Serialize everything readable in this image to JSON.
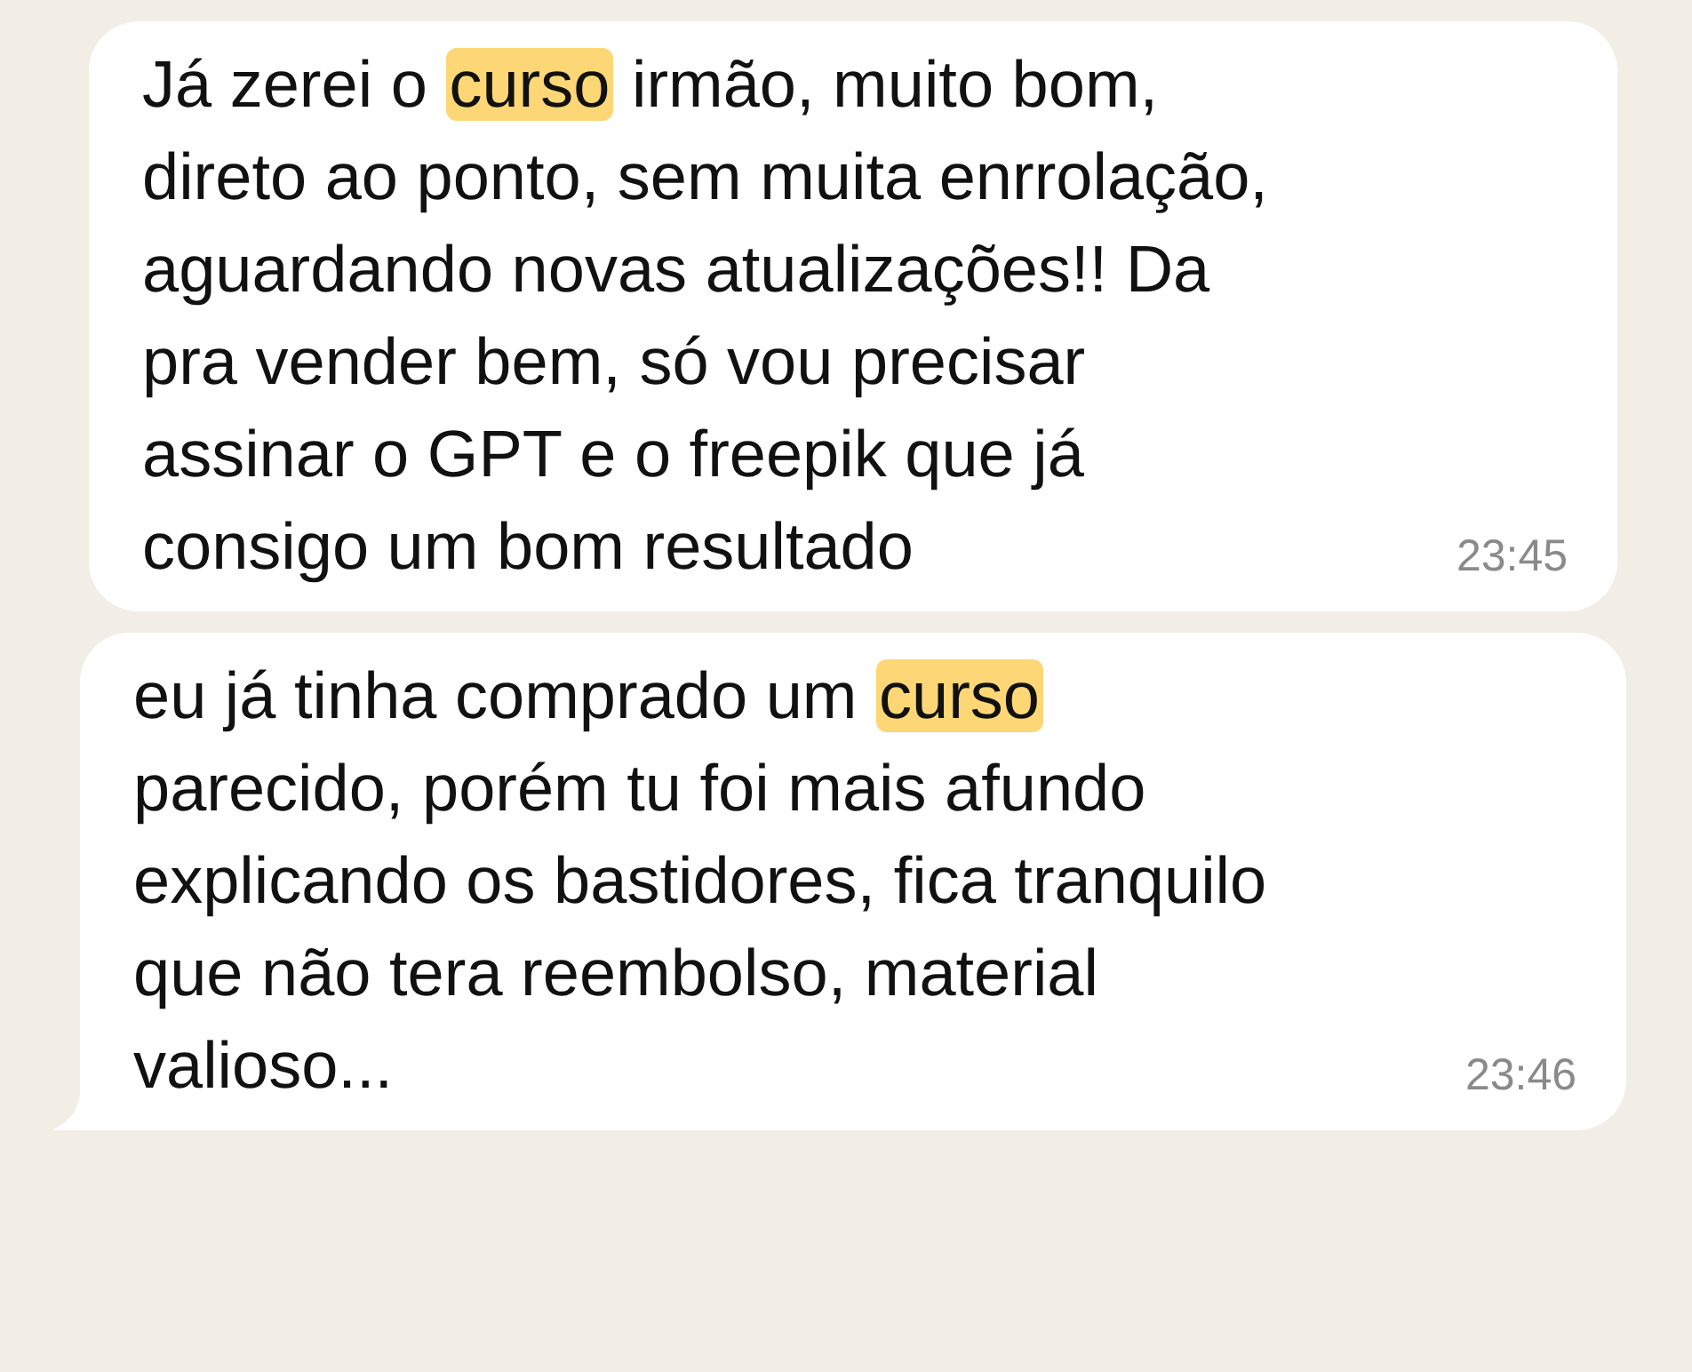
{
  "messages": [
    {
      "lines": [
        [
          {
            "text": "Já zerei o ",
            "highlighted": false
          },
          {
            "text": "curso",
            "highlighted": true
          },
          {
            "text": " irmão, muito bom,",
            "highlighted": false
          }
        ],
        [
          {
            "text": "direto ao ponto, sem muita enrrolação,",
            "highlighted": false
          }
        ],
        [
          {
            "text": "aguardando novas atualizações!! Da",
            "highlighted": false
          }
        ],
        [
          {
            "text": "pra vender bem, só vou precisar",
            "highlighted": false
          }
        ],
        [
          {
            "text": "assinar o GPT e o freepik que já",
            "highlighted": false
          }
        ],
        [
          {
            "text": "consigo um bom resultado",
            "highlighted": false
          }
        ]
      ],
      "time": "23:45",
      "tail": false
    },
    {
      "lines": [
        [
          {
            "text": "eu já tinha comprado um ",
            "highlighted": false
          },
          {
            "text": "curso",
            "highlighted": true
          }
        ],
        [
          {
            "text": "parecido, porém tu foi mais afundo",
            "highlighted": false
          }
        ],
        [
          {
            "text": "explicando os bastidores, fica tranquilo",
            "highlighted": false
          }
        ],
        [
          {
            "text": "que não tera reembolso, material",
            "highlighted": false
          }
        ],
        [
          {
            "text": "valioso...",
            "highlighted": false
          }
        ]
      ],
      "time": "23:46",
      "tail": true
    }
  ]
}
